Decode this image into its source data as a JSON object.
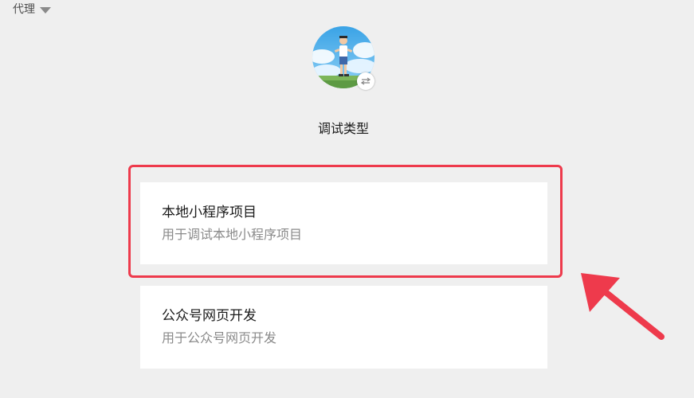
{
  "proxy": {
    "label": "代理",
    "icon": "caret-down-icon"
  },
  "avatar": {
    "badge_icon": "switch-arrows-icon"
  },
  "page": {
    "title": "调试类型"
  },
  "debug_types": [
    {
      "title": "本地小程序项目",
      "description": "用于调试本地小程序项目",
      "highlighted": true
    },
    {
      "title": "公众号网页开发",
      "description": "用于公众号网页开发",
      "highlighted": false
    }
  ],
  "annotation": {
    "color": "#ee3a4c",
    "icon": "arrow-icon"
  }
}
